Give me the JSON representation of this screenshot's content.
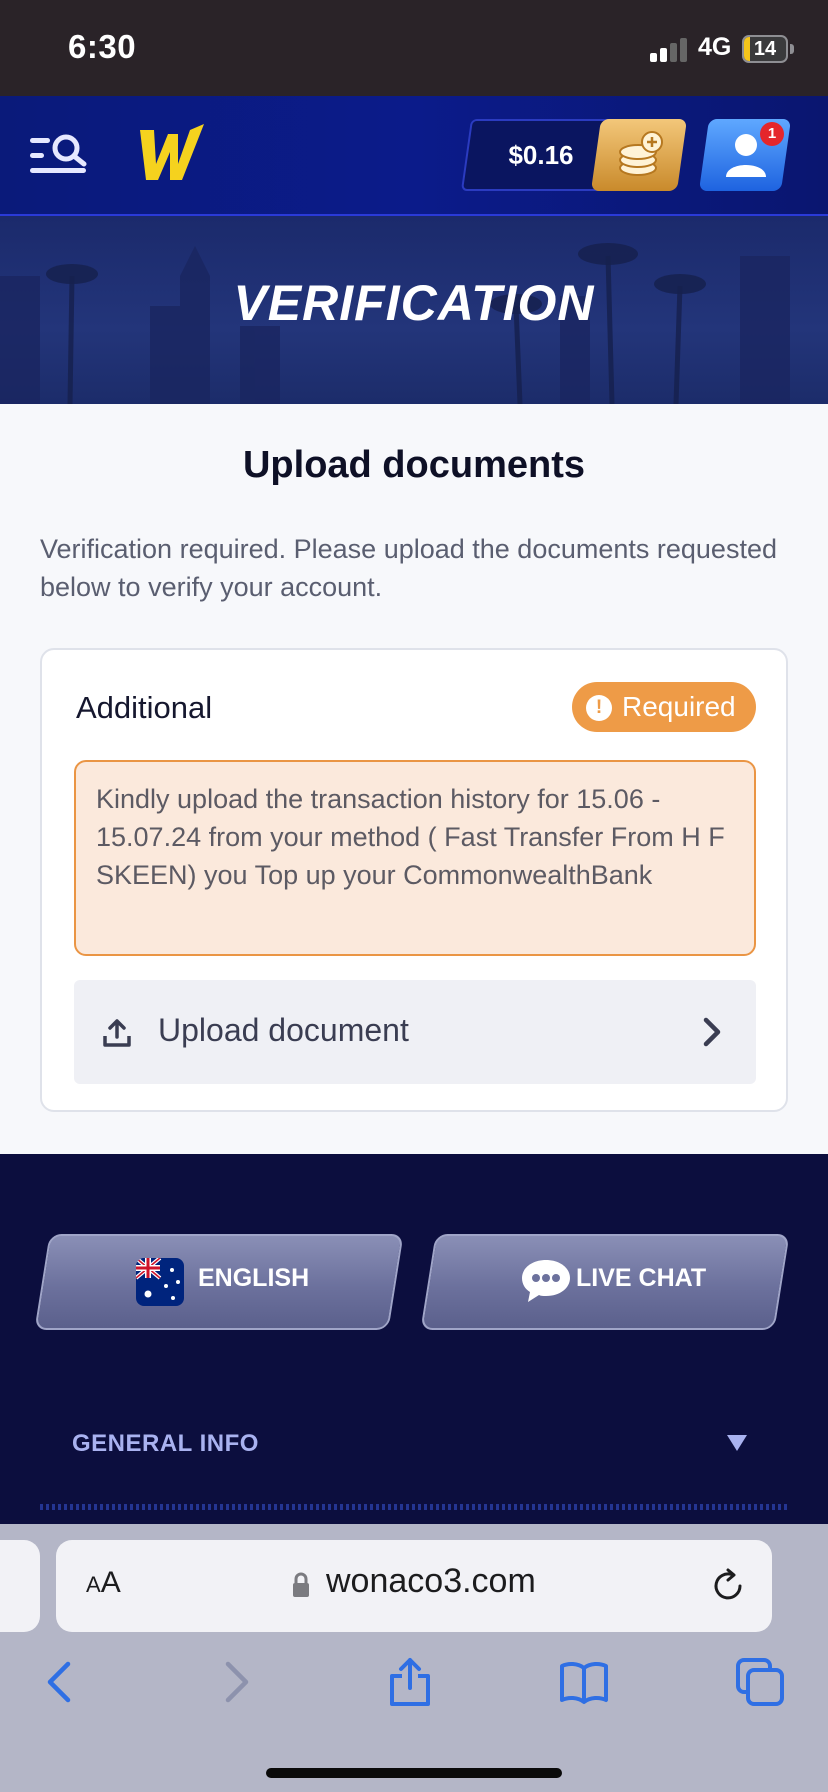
{
  "status_bar": {
    "time": "6:30",
    "network": "4G",
    "battery": "14",
    "battery_level": 0.14
  },
  "header": {
    "balance": "$0.16",
    "notification_count": "1"
  },
  "banner": {
    "title": "VERIFICATION"
  },
  "content": {
    "title": "Upload documents",
    "intro": "Verification required. Please upload the documents requested below to verify your account.",
    "card": {
      "title": "Additional",
      "badge": "Required",
      "note": "Kindly upload the transaction history for 15.06 - 15.07.24 from your method ( Fast Transfer From H F SKEEN) you Top up your CommonwealthBank",
      "upload_label": "Upload document"
    }
  },
  "footer": {
    "language_button": "ENGLISH",
    "chat_button": "LIVE CHAT",
    "general_info": "GENERAL INFO"
  },
  "browser": {
    "aa_small": "A",
    "aa_large": "A",
    "url": "wonaco3.com"
  },
  "colors": {
    "header_bg": "#0b1b8a",
    "required_badge": "#ee9b47",
    "footer_bg": "#0c0e3e",
    "accent_gold": "#f5d21e"
  }
}
